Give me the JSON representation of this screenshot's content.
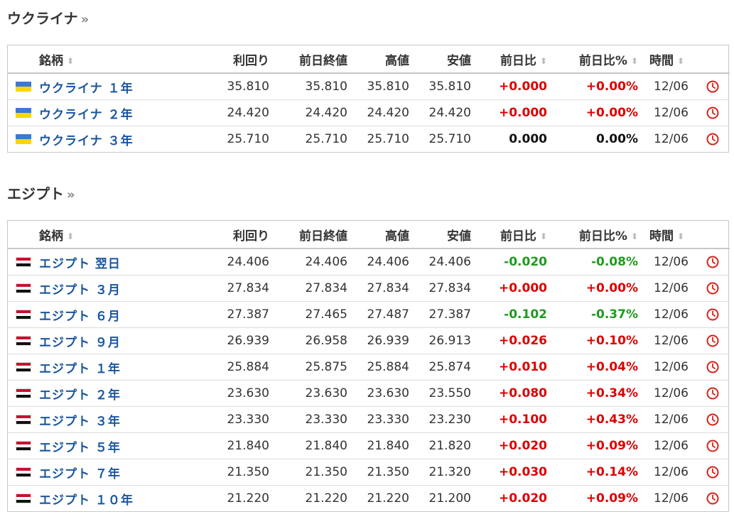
{
  "sections": [
    {
      "title": "ウクライナ",
      "more": "»",
      "columns": {
        "name": "銘柄",
        "yield": "利回り",
        "prev_close": "前日終値",
        "high": "高値",
        "low": "安値",
        "change": "前日比",
        "change_pct": "前日比%",
        "time": "時間",
        "sort_icon": "⬍"
      },
      "rows": [
        {
          "flag": "ukraine-flag",
          "name": "ウクライナ １年",
          "yield": "35.810",
          "prev_close": "35.810",
          "high": "35.810",
          "low": "35.810",
          "change": "+0.000",
          "change_pct": "+0.00%",
          "time": "12/06",
          "dir": "up"
        },
        {
          "flag": "ukraine-flag",
          "name": "ウクライナ ２年",
          "yield": "24.420",
          "prev_close": "24.420",
          "high": "24.420",
          "low": "24.420",
          "change": "+0.000",
          "change_pct": "+0.00%",
          "time": "12/06",
          "dir": "up"
        },
        {
          "flag": "ukraine-flag",
          "name": "ウクライナ ３年",
          "yield": "25.710",
          "prev_close": "25.710",
          "high": "25.710",
          "low": "25.710",
          "change": "0.000",
          "change_pct": "0.00%",
          "time": "12/06",
          "dir": "flat"
        }
      ]
    },
    {
      "title": "エジプト",
      "more": "»",
      "columns": {
        "name": "銘柄",
        "yield": "利回り",
        "prev_close": "前日終値",
        "high": "高値",
        "low": "安値",
        "change": "前日比",
        "change_pct": "前日比%",
        "time": "時間",
        "sort_icon": "⬍"
      },
      "rows": [
        {
          "flag": "egypt-flag",
          "name": "エジプト 翌日",
          "yield": "24.406",
          "prev_close": "24.406",
          "high": "24.406",
          "low": "24.406",
          "change": "-0.020",
          "change_pct": "-0.08%",
          "time": "12/06",
          "dir": "down"
        },
        {
          "flag": "egypt-flag",
          "name": "エジプト ３月",
          "yield": "27.834",
          "prev_close": "27.834",
          "high": "27.834",
          "low": "27.834",
          "change": "+0.000",
          "change_pct": "+0.00%",
          "time": "12/06",
          "dir": "up"
        },
        {
          "flag": "egypt-flag",
          "name": "エジプト ６月",
          "yield": "27.387",
          "prev_close": "27.465",
          "high": "27.487",
          "low": "27.387",
          "change": "-0.102",
          "change_pct": "-0.37%",
          "time": "12/06",
          "dir": "down"
        },
        {
          "flag": "egypt-flag",
          "name": "エジプト ９月",
          "yield": "26.939",
          "prev_close": "26.958",
          "high": "26.939",
          "low": "26.913",
          "change": "+0.026",
          "change_pct": "+0.10%",
          "time": "12/06",
          "dir": "up"
        },
        {
          "flag": "egypt-flag",
          "name": "エジプト １年",
          "yield": "25.884",
          "prev_close": "25.875",
          "high": "25.884",
          "low": "25.874",
          "change": "+0.010",
          "change_pct": "+0.04%",
          "time": "12/06",
          "dir": "up"
        },
        {
          "flag": "egypt-flag",
          "name": "エジプト ２年",
          "yield": "23.630",
          "prev_close": "23.630",
          "high": "23.630",
          "low": "23.550",
          "change": "+0.080",
          "change_pct": "+0.34%",
          "time": "12/06",
          "dir": "up"
        },
        {
          "flag": "egypt-flag",
          "name": "エジプト ３年",
          "yield": "23.330",
          "prev_close": "23.330",
          "high": "23.330",
          "low": "23.230",
          "change": "+0.100",
          "change_pct": "+0.43%",
          "time": "12/06",
          "dir": "up"
        },
        {
          "flag": "egypt-flag",
          "name": "エジプト ５年",
          "yield": "21.840",
          "prev_close": "21.840",
          "high": "21.840",
          "low": "21.820",
          "change": "+0.020",
          "change_pct": "+0.09%",
          "time": "12/06",
          "dir": "up"
        },
        {
          "flag": "egypt-flag",
          "name": "エジプト ７年",
          "yield": "21.350",
          "prev_close": "21.350",
          "high": "21.350",
          "low": "21.320",
          "change": "+0.030",
          "change_pct": "+0.14%",
          "time": "12/06",
          "dir": "up"
        },
        {
          "flag": "egypt-flag",
          "name": "エジプト １０年",
          "yield": "21.220",
          "prev_close": "21.220",
          "high": "21.220",
          "low": "21.200",
          "change": "+0.020",
          "change_pct": "+0.09%",
          "time": "12/06",
          "dir": "up"
        }
      ]
    }
  ],
  "row_icon": "clock-icon",
  "colors": {
    "up": "#dd0000",
    "down": "#1f9a1f",
    "flat": "#111111",
    "link": "#1a56a0",
    "clock": "#d9231a"
  }
}
